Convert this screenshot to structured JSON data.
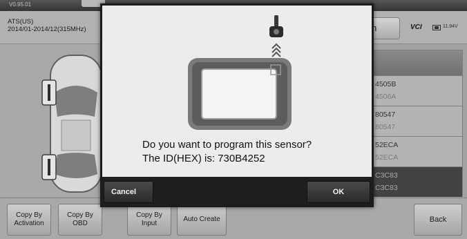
{
  "top_bar": {
    "version": "V0.95.01"
  },
  "header": {
    "vehicle_region": "ATS(US)",
    "vehicle_years": "2014/01-2014/12(315MHz)",
    "partial_button": "n",
    "vci_label": "VCI",
    "battery_text": "11.94V"
  },
  "sensor_list": {
    "rows": [
      {
        "top": "4505B",
        "bottom": "4506A",
        "dark": false
      },
      {
        "top": "80547",
        "bottom": "80547",
        "dark": false
      },
      {
        "top": "52ECA",
        "bottom": "52ECA",
        "dark": false
      },
      {
        "top": "C3C83",
        "bottom": "C3C83",
        "dark": true
      }
    ]
  },
  "toolbar": {
    "copy_by_activation": "Copy By Activation",
    "copy_by_obd": "Copy By OBD",
    "copy_by_input": "Copy By Input",
    "auto_create": "Auto Create",
    "back": "Back"
  },
  "dialog": {
    "question": "Do you want to program this sensor?",
    "id_line": "The ID(HEX) is: 730B4252",
    "cancel": "Cancel",
    "ok": "OK"
  },
  "icons": [
    "tablet-icon",
    "tpms-sensor-icon",
    "signal-arrows-icon",
    "car-icon",
    "battery-icon"
  ]
}
